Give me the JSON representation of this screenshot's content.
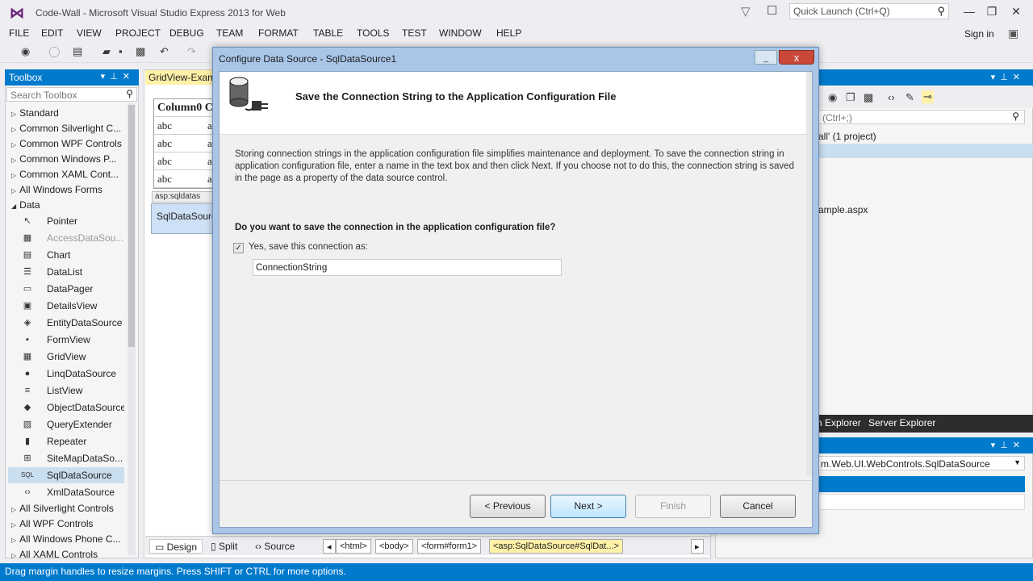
{
  "window": {
    "title": "Code-Wall - Microsoft Visual Studio Express 2013 for Web",
    "quick_launch_placeholder": "Quick Launch (Ctrl+Q)",
    "sign_in": "Sign in"
  },
  "menu": [
    "FILE",
    "EDIT",
    "VIEW",
    "PROJECT",
    "DEBUG",
    "TEAM",
    "FORMAT",
    "TABLE",
    "TOOLS",
    "TEST",
    "WINDOW",
    "HELP"
  ],
  "toolbox": {
    "title": "Toolbox",
    "search_placeholder": "Search Toolbox",
    "items": [
      {
        "label": "Standard",
        "type": "category",
        "arrow": "▷"
      },
      {
        "label": "Common Silverlight C...",
        "type": "category",
        "arrow": "▷"
      },
      {
        "label": "Common WPF Controls",
        "type": "category",
        "arrow": "▷"
      },
      {
        "label": "Common Windows P...",
        "type": "category",
        "arrow": "▷"
      },
      {
        "label": "Common XAML Cont...",
        "type": "category",
        "arrow": "▷"
      },
      {
        "label": "All Windows Forms",
        "type": "category",
        "arrow": "▷"
      },
      {
        "label": "Data",
        "type": "category",
        "arrow": "◢"
      },
      {
        "label": "Pointer",
        "type": "item",
        "icon": "pointer-icon",
        "glyph": "↖"
      },
      {
        "label": "AccessDataSou...",
        "type": "item",
        "icon": "access-datasource-icon",
        "glyph": "▦",
        "disabled": true
      },
      {
        "label": "Chart",
        "type": "item",
        "icon": "chart-icon",
        "glyph": "▤"
      },
      {
        "label": "DataList",
        "type": "item",
        "icon": "datalist-icon",
        "glyph": "☰"
      },
      {
        "label": "DataPager",
        "type": "item",
        "icon": "datapager-icon",
        "glyph": "▭"
      },
      {
        "label": "DetailsView",
        "type": "item",
        "icon": "detailsview-icon",
        "glyph": "▣"
      },
      {
        "label": "EntityDataSource",
        "type": "item",
        "icon": "entity-datasource-icon",
        "glyph": "◈"
      },
      {
        "label": "FormView",
        "type": "item",
        "icon": "formview-icon",
        "glyph": "▪"
      },
      {
        "label": "GridView",
        "type": "item",
        "icon": "gridview-icon",
        "glyph": "▦"
      },
      {
        "label": "LinqDataSource",
        "type": "item",
        "icon": "linq-datasource-icon",
        "glyph": "●"
      },
      {
        "label": "ListView",
        "type": "item",
        "icon": "listview-icon",
        "glyph": "≡"
      },
      {
        "label": "ObjectDataSource",
        "type": "item",
        "icon": "object-datasource-icon",
        "glyph": "◆"
      },
      {
        "label": "QueryExtender",
        "type": "item",
        "icon": "queryextender-icon",
        "glyph": "▧"
      },
      {
        "label": "Repeater",
        "type": "item",
        "icon": "repeater-icon",
        "glyph": "▮"
      },
      {
        "label": "SiteMapDataSo...",
        "type": "item",
        "icon": "sitemap-datasource-icon",
        "glyph": "⊞"
      },
      {
        "label": "SqlDataSource",
        "type": "item",
        "icon": "sql-datasource-icon",
        "glyph": "SQL",
        "selected": true
      },
      {
        "label": "XmlDataSource",
        "type": "item",
        "icon": "xml-datasource-icon",
        "glyph": "‹›"
      },
      {
        "label": "All Silverlight Controls",
        "type": "category",
        "arrow": "▷"
      },
      {
        "label": "All WPF Controls",
        "type": "category",
        "arrow": "▷"
      },
      {
        "label": "All Windows Phone C...",
        "type": "category",
        "arrow": "▷"
      },
      {
        "label": "All XAML Controls",
        "type": "category",
        "arrow": "▷"
      }
    ]
  },
  "editor": {
    "doc_tab": "GridView-Exam",
    "gridview": {
      "header": "Column0 C",
      "cells": [
        "abc",
        "abc",
        "abc",
        "abc"
      ],
      "col2": [
        "a",
        "a",
        "a",
        "a"
      ]
    },
    "sql_tag": "asp:sqldatas",
    "sql_control": "SqlDataSourc",
    "view_tabs": [
      "Design",
      "Split",
      "Source"
    ],
    "breadcrumbs": [
      "<html>",
      "<body>",
      "<form#form1>",
      "<asp:SqlDataSource#SqlDat...>"
    ]
  },
  "solution_explorer": {
    "search_placeholder": "(Ctrl+;)",
    "row1": "all' (1 project)",
    "row2": "ample.aspx",
    "tabs": [
      "n Explorer",
      "Server Explorer"
    ]
  },
  "properties": {
    "object": "m.Web.UI.WebControls.SqlDataSource"
  },
  "status": "Drag margin handles to resize margins. Press SHIFT or CTRL for more options.",
  "dialog": {
    "title": "Configure Data Source - SqlDataSource1",
    "close": "x",
    "heading": "Save the Connection String to the Application Configuration File",
    "description": "Storing connection strings in the application configuration file simplifies maintenance and deployment. To save the connection string in application configuration file, enter a name in the text box and then click Next. If you choose not to do this, the connection string is saved in the page as a property of the data source control.",
    "question": "Do you want to save the connection in the application configuration file?",
    "checkbox_label": "Yes, save this connection as:",
    "checkbox_checked": true,
    "connection_name": "ConnectionString",
    "buttons": {
      "previous": "< Previous",
      "next": "Next >",
      "finish": "Finish",
      "cancel": "Cancel"
    }
  },
  "colors": {
    "accent": "#007acc",
    "selection": "#c9dff0",
    "highlight": "#fff1a8"
  }
}
